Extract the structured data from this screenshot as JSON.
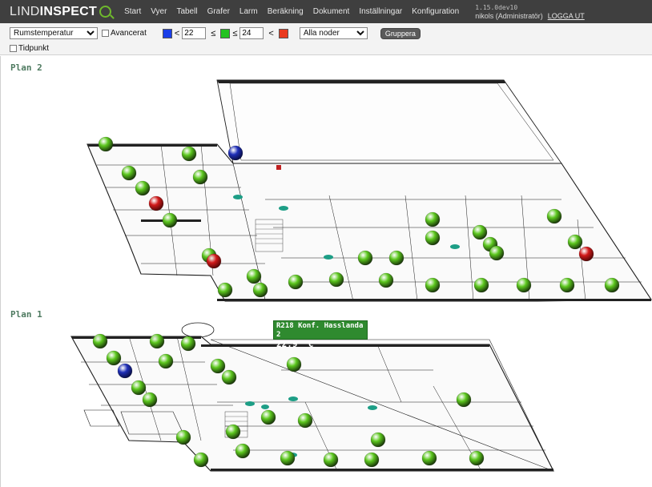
{
  "app": {
    "logo_part1": "LIND",
    "logo_part2": "INSPECT"
  },
  "nav": {
    "items": [
      {
        "label": "Start"
      },
      {
        "label": "Vyer"
      },
      {
        "label": "Tabell"
      },
      {
        "label": "Grafer"
      },
      {
        "label": "Larm"
      },
      {
        "label": "Beräkning"
      },
      {
        "label": "Dokument"
      },
      {
        "label": "Inställningar"
      },
      {
        "label": "Konfiguration"
      }
    ],
    "version": "1.15.0dev10",
    "user": "nikols (Administratör)",
    "logout": "LOGGA UT"
  },
  "toolbar": {
    "measure_select": "Rumstemperatur",
    "advanced_label": "Avancerat",
    "low_threshold": "22",
    "high_threshold": "24",
    "lt_symbol": "<",
    "le_symbol": "≤",
    "nodes_select": "Alla noder",
    "group_button": "Gruppera",
    "timepoint_label": "Tidpunkt",
    "colors": {
      "low": "#1a3ee8",
      "mid": "#25c322",
      "high": "#ea3b1f"
    }
  },
  "plans": [
    {
      "title": "Plan 2",
      "sensors": {
        "green": 34,
        "red": 3,
        "blue": 1
      }
    },
    {
      "title": "Plan 1",
      "sensors": {
        "green": 29,
        "red": 0,
        "blue": 1
      }
    }
  ],
  "tooltip": {
    "name": "R218 Konf. Hasslanda 2",
    "value": "22,9 °C"
  },
  "sensor_colors": {
    "green": "#5cc71e",
    "red": "#d21a1a",
    "blue": "#1f2fb8"
  }
}
